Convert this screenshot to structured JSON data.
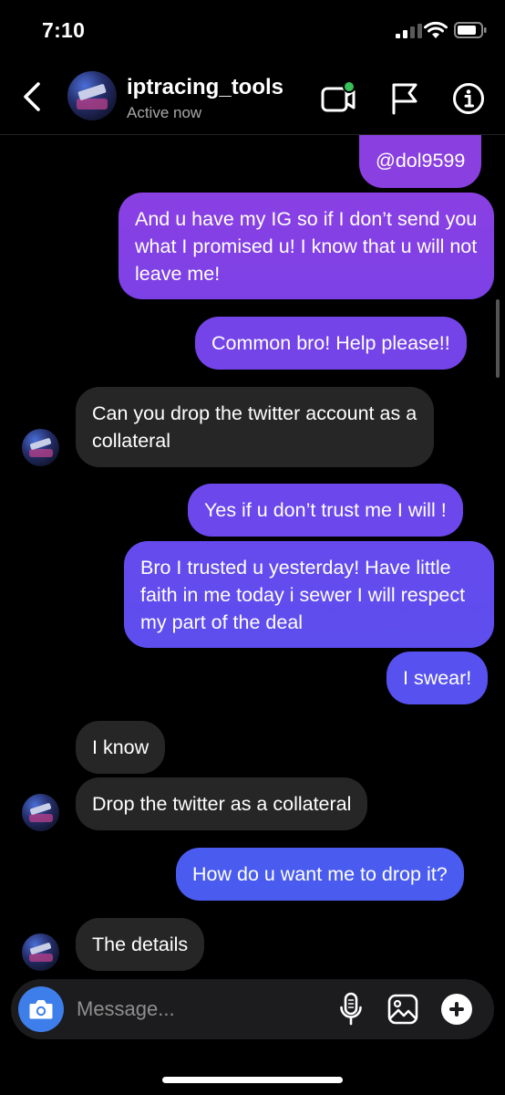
{
  "status_bar": {
    "time": "7:10"
  },
  "header": {
    "name": "iptracing_tools",
    "status": "Active now",
    "icons": [
      "back-icon",
      "video-call-icon",
      "flag-icon",
      "info-icon"
    ]
  },
  "colors": {
    "sent_top": "#8a3fe0",
    "sent_mid": "#6c49ec",
    "sent_bottom": "#4a5cf0",
    "received": "#262626",
    "background": "#000000",
    "camera_button": "#3d7eea",
    "active_dot": "#37c15a"
  },
  "messages": [
    {
      "from": "me",
      "text": "@dol9599"
    },
    {
      "from": "me",
      "text": "And u have my IG so if I don’t send you what I promised u! I know that u will not leave me!"
    },
    {
      "from": "me",
      "text": "Common bro! Help please!!"
    },
    {
      "from": "them",
      "text": "Can you drop the twitter account as a collateral"
    },
    {
      "from": "me",
      "text": "Yes if u don’t trust me I will !"
    },
    {
      "from": "me",
      "text": "Bro I trusted u yesterday! Have little faith in me today i sewer I will respect my part of the deal"
    },
    {
      "from": "me",
      "text": "I swear!"
    },
    {
      "from": "them",
      "text": "I know"
    },
    {
      "from": "them",
      "text": "Drop the twitter as a collateral"
    },
    {
      "from": "me",
      "text": "How do u want me to drop it?"
    },
    {
      "from": "them",
      "text": "The details"
    }
  ],
  "composer": {
    "placeholder": "Message...",
    "icons": [
      "camera-icon",
      "microphone-icon",
      "gallery-icon",
      "add-icon"
    ]
  }
}
